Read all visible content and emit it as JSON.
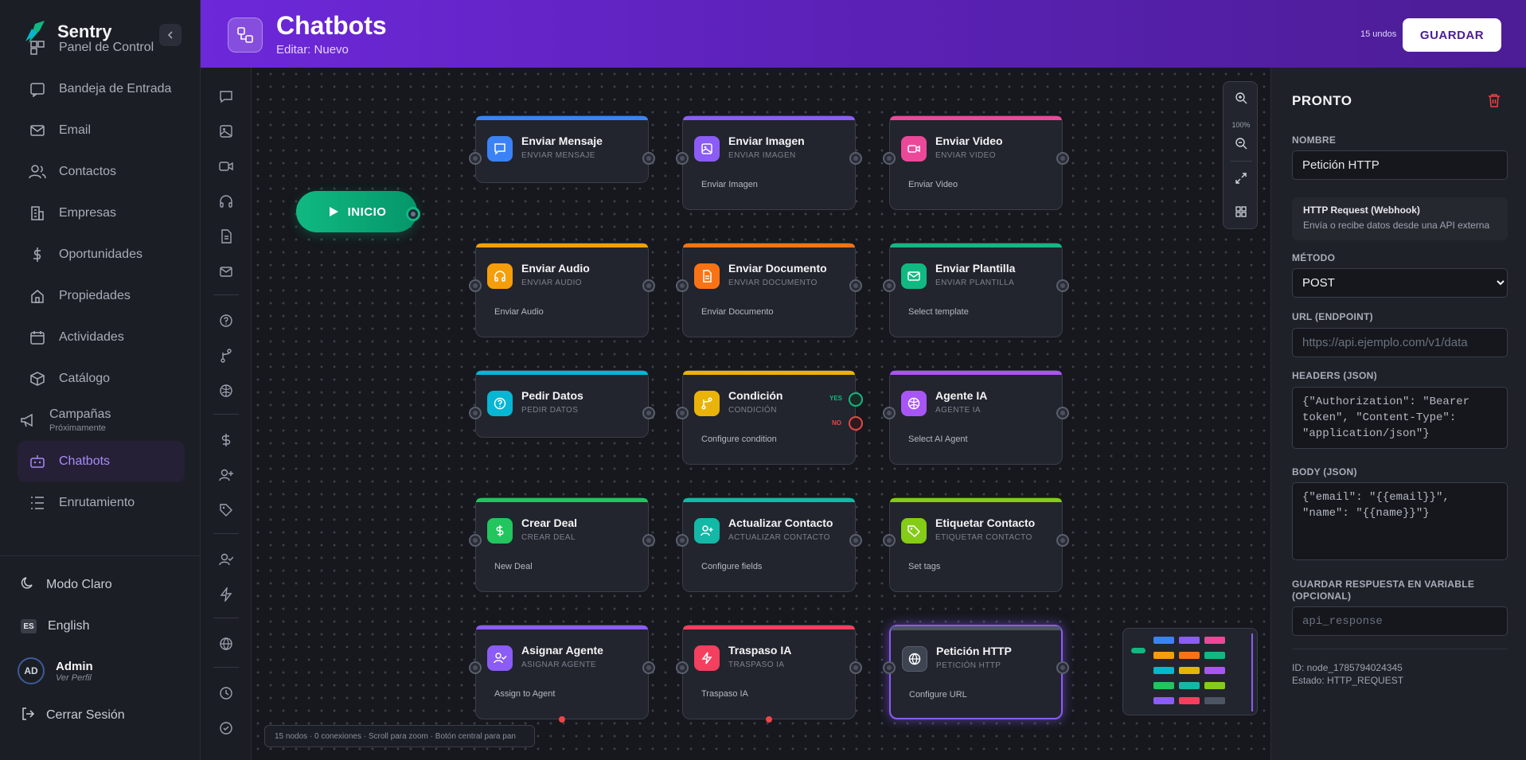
{
  "app": {
    "name": "Sentry"
  },
  "sidebar": {
    "items": [
      {
        "label": "Panel de Control",
        "icon": "dashboard-icon"
      },
      {
        "label": "Bandeja de Entrada",
        "icon": "inbox-icon"
      },
      {
        "label": "Email",
        "icon": "mail-icon"
      },
      {
        "label": "Contactos",
        "icon": "users-icon"
      },
      {
        "label": "Empresas",
        "icon": "building-icon"
      },
      {
        "label": "Oportunidades",
        "icon": "dollar-icon"
      },
      {
        "label": "Propiedades",
        "icon": "home-icon"
      },
      {
        "label": "Actividades",
        "icon": "calendar-icon"
      },
      {
        "label": "Catálogo",
        "icon": "box-icon"
      },
      {
        "label": "Campañas",
        "sub": "Próximamente",
        "icon": "megaphone-icon"
      },
      {
        "label": "Chatbots",
        "icon": "bot-icon",
        "active": true
      },
      {
        "label": "Enrutamiento",
        "icon": "routing-icon"
      }
    ],
    "theme_toggle": "Modo Claro",
    "language_badge": "ES",
    "language": "English",
    "user": {
      "initials": "AD",
      "name": "Admin",
      "sub": "Ver Perfil"
    },
    "logout": "Cerrar Sesión"
  },
  "header": {
    "title": "Chatbots",
    "subtitle": "Editar: Nuevo",
    "undo_count": "15 undos",
    "save_label": "GUARDAR"
  },
  "canvas": {
    "start_label": "INICIO",
    "zoom_level": "100%",
    "status_text": "15 nodos · 0 conexiones · Scroll para zoom · Botón central para pan",
    "yes_label": "YES",
    "no_label": "NO",
    "nodes": [
      {
        "title": "Enviar Mensaje",
        "sub": "ENVIAR MENSAJE",
        "desc": "",
        "color": "#3b82f6"
      },
      {
        "title": "Enviar Imagen",
        "sub": "ENVIAR IMAGEN",
        "desc": "Enviar Imagen",
        "color": "#8b5cf6"
      },
      {
        "title": "Enviar Video",
        "sub": "ENVIAR VIDEO",
        "desc": "Enviar Video",
        "color": "#ec4899"
      },
      {
        "title": "Enviar Audio",
        "sub": "ENVIAR AUDIO",
        "desc": "Enviar Audio",
        "color": "#f59e0b"
      },
      {
        "title": "Enviar Documento",
        "sub": "ENVIAR DOCUMENTO",
        "desc": "Enviar Documento",
        "color": "#f97316"
      },
      {
        "title": "Enviar Plantilla",
        "sub": "ENVIAR PLANTILLA",
        "desc": "Select template",
        "color": "#10b981"
      },
      {
        "title": "Pedir Datos",
        "sub": "PEDIR DATOS",
        "desc": "",
        "color": "#06b6d4"
      },
      {
        "title": "Condición",
        "sub": "CONDICIÓN",
        "desc": "Configure condition",
        "color": "#eab308"
      },
      {
        "title": "Agente IA",
        "sub": "AGENTE IA",
        "desc": "Select AI Agent",
        "color": "#a855f7"
      },
      {
        "title": "Crear Deal",
        "sub": "CREAR DEAL",
        "desc": "New Deal",
        "color": "#22c55e"
      },
      {
        "title": "Actualizar Contacto",
        "sub": "ACTUALIZAR CONTACTO",
        "desc": "Configure fields",
        "color": "#14b8a6"
      },
      {
        "title": "Etiquetar Contacto",
        "sub": "ETIQUETAR CONTACTO",
        "desc": "Set tags",
        "color": "#84cc16"
      },
      {
        "title": "Asignar Agente",
        "sub": "ASIGNAR AGENTE",
        "desc": "Assign to Agent",
        "color": "#8b5cf6"
      },
      {
        "title": "Traspaso IA",
        "sub": "TRASPASO IA",
        "desc": "Traspaso IA",
        "color": "#f43f5e"
      },
      {
        "title": "Petición HTTP",
        "sub": "PETICIÓN HTTP",
        "desc": "Configure URL",
        "color": "#4b5563"
      }
    ]
  },
  "panel": {
    "title": "PRONTO",
    "name_label": "NOMBRE",
    "name_value": "Petición HTTP",
    "info_title": "HTTP Request (Webhook)",
    "info_desc": "Envía o recibe datos desde una API externa",
    "method_label": "MÉTODO",
    "method_value": "POST",
    "url_label": "URL (ENDPOINT)",
    "url_placeholder": "https://api.ejemplo.com/v1/data",
    "headers_label": "HEADERS (JSON)",
    "headers_value": "{\"Authorization\": \"Bearer token\", \"Content-Type\": \"application/json\"}",
    "body_label": "BODY (JSON)",
    "body_value": "{\"email\": \"{{email}}\", \"name\": \"{{name}}\"}",
    "save_var_label_1": "GUARDAR RESPUESTA EN VARIABLE",
    "save_var_label_2": "(OPCIONAL)",
    "save_var_placeholder": "api_response",
    "meta_id": "ID: node_1785794024345",
    "meta_state": "Estado: HTTP_REQUEST"
  }
}
